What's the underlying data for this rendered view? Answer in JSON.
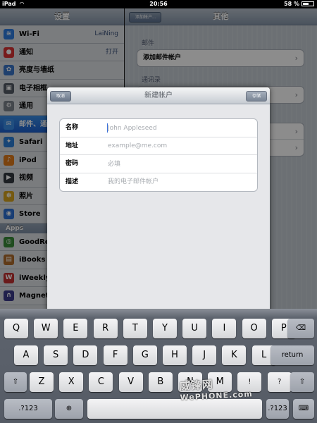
{
  "status_bar": {
    "device": "iPad",
    "time": "20:56",
    "battery": "58 %",
    "battery_level": 0.58
  },
  "left_pane": {
    "title": "设置",
    "items": [
      {
        "label": "Wi-Fi",
        "value": "LaiNing",
        "icon": "wifi-icon",
        "color": "#2f7de1",
        "glyph": "≋"
      },
      {
        "label": "通知",
        "value": "打开",
        "icon": "notifications-icon",
        "color": "#d93434",
        "glyph": "●"
      },
      {
        "label": "亮度与墙纸",
        "value": "",
        "icon": "brightness-icon",
        "color": "#3a76c9",
        "glyph": "✿"
      },
      {
        "label": "电子相框",
        "value": "",
        "icon": "picture-frame-icon",
        "color": "#555c66",
        "glyph": "▣"
      },
      {
        "label": "通用",
        "value": "",
        "icon": "gear-icon",
        "color": "#7d848d",
        "glyph": "⚙"
      },
      {
        "label": "邮件、通",
        "value": "",
        "icon": "mail-icon",
        "color": "#3b8fe8",
        "glyph": "✉",
        "selected": true
      },
      {
        "label": "Safari",
        "value": "",
        "icon": "safari-icon",
        "color": "#2d7fd8",
        "glyph": "✦"
      },
      {
        "label": "iPod",
        "value": "",
        "icon": "ipod-icon",
        "color": "#e07a1a",
        "glyph": "♪"
      },
      {
        "label": "视频",
        "value": "",
        "icon": "video-icon",
        "color": "#333940",
        "glyph": "▶"
      },
      {
        "label": "照片",
        "value": "",
        "icon": "photos-icon",
        "color": "#d6a21e",
        "glyph": "✽"
      },
      {
        "label": "Store",
        "value": "",
        "icon": "store-icon",
        "color": "#2d6fd3",
        "glyph": "◉"
      }
    ],
    "apps_section": "Apps",
    "apps": [
      {
        "label": "GoodRe",
        "icon": "goodreader-icon",
        "color": "#3a8a3a",
        "glyph": "◎"
      },
      {
        "label": "iBooks",
        "icon": "ibooks-icon",
        "color": "#b06c2c",
        "glyph": "▤"
      },
      {
        "label": "iWeekly",
        "icon": "iweekly-icon",
        "color": "#c23030",
        "glyph": "W"
      },
      {
        "label": "MagnetM",
        "icon": "magnet-icon",
        "color": "#3b3b8a",
        "glyph": "∩"
      }
    ]
  },
  "right_pane": {
    "title": "其他",
    "back_label": "添加帐户...",
    "mail_section": "邮件",
    "add_mail": "添加邮件帐户",
    "contacts_section": "通讯录",
    "chevron": "›"
  },
  "modal": {
    "title": "新建帐户",
    "cancel": "取消",
    "save": "存储",
    "fields": [
      {
        "label": "名称",
        "placeholder": "John Appleseed"
      },
      {
        "label": "地址",
        "placeholder": "example@me.com"
      },
      {
        "label": "密码",
        "placeholder": "必填"
      },
      {
        "label": "描述",
        "placeholder": "我的电子邮件帐户"
      }
    ]
  },
  "keyboard": {
    "row1": [
      "Q",
      "W",
      "E",
      "R",
      "T",
      "Y",
      "U",
      "I",
      "O",
      "P"
    ],
    "row2": [
      "A",
      "S",
      "D",
      "F",
      "G",
      "H",
      "J",
      "K",
      "L"
    ],
    "row3": [
      "Z",
      "X",
      "C",
      "V",
      "B",
      "N",
      "M",
      "!",
      "?"
    ],
    "backspace": "⌫",
    "return": "return",
    "shift": "⇧",
    "numbers": ".?123",
    "globe": "⊕",
    "hide": "⌨"
  },
  "watermark": {
    "text": "威锋网",
    "sub": "WePHONE.com"
  }
}
